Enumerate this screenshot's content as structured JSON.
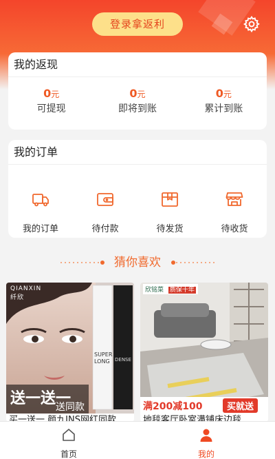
{
  "colors": {
    "accent": "#ef4a23",
    "header": "#f4452b",
    "login_bg": "#fde08a"
  },
  "header": {
    "login_label": "登录拿返利",
    "settings_icon": "gear-icon"
  },
  "cashback": {
    "title": "我的返现",
    "unit": "元",
    "items": [
      {
        "amount": "0",
        "label": "可提现"
      },
      {
        "amount": "0",
        "label": "即将到账"
      },
      {
        "amount": "0",
        "label": "累计到账"
      }
    ]
  },
  "orders": {
    "title": "我的订单",
    "items": [
      {
        "label": "我的订单",
        "icon": "truck-icon"
      },
      {
        "label": "待付款",
        "icon": "wallet-icon"
      },
      {
        "label": "待发货",
        "icon": "box-icon"
      },
      {
        "label": "待收货",
        "icon": "store-icon"
      }
    ]
  },
  "recommend": {
    "title": "猜你喜欢"
  },
  "products": [
    {
      "brand": "QIANXIN",
      "brand_cn": "纤欣",
      "promo": "送一送一",
      "promo_sub": "送同款",
      "tube1_a": "SUPER",
      "tube1_b": "LONG",
      "tube2": "DENSE",
      "title": "买一送一 颜九INS网红同款"
    },
    {
      "brand": "欣铭菜",
      "tag": "质保十年",
      "promo": "满200减100",
      "promo_btn": "买就送",
      "title": "地毯客厅卧室满铺床边毯"
    }
  ],
  "tabbar": [
    {
      "label": "首页",
      "icon": "home-icon",
      "active": false
    },
    {
      "label": "我的",
      "icon": "user-icon",
      "active": true
    }
  ]
}
